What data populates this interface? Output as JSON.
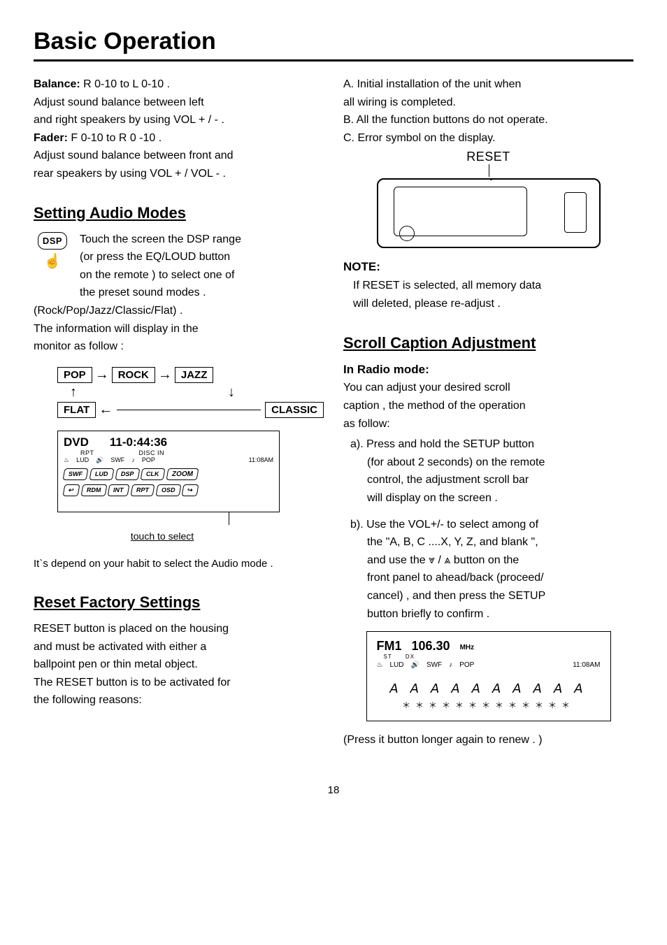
{
  "title": "Basic Operation",
  "left": {
    "balance_label": "Balance:",
    "balance_range": " R 0-10 to L 0-10 .",
    "balance_desc1": "Adjust sound balance between left",
    "balance_desc2": "and right speakers by using VOL + / - .",
    "fader_label": "Fader:",
    "fader_range": " F 0-10 to R 0 -10 .",
    "fader_desc1": "Adjust sound balance between front and",
    "fader_desc2": "rear speakers by using VOL + / VOL - .",
    "heading_audio": "Setting Audio Modes",
    "dsp_badge": "DSP",
    "dsp_text1": "Touch the screen the DSP range",
    "dsp_text2": "(or press the EQ/LOUD button",
    "dsp_text3": "on the remote ) to select one of",
    "dsp_text4": "the preset sound modes .",
    "dsp_after1": " (Rock/Pop/Jazz/Classic/Flat) .",
    "dsp_after2": "The information will display in the",
    "dsp_after3": "monitor as follow :",
    "flow": {
      "pop": "POP",
      "rock": "ROCK",
      "jazz": "JAZZ",
      "flat": "FLAT",
      "classic": "CLASSIC"
    },
    "dvd": {
      "name": "DVD",
      "time": "11-0:44:36",
      "rpt": "RPT",
      "discin": "DISC IN",
      "ico1": "LUD",
      "ico2": "SWF",
      "ico3": "POP",
      "clock": "11:08AM",
      "btn_row1": [
        "SWF",
        "LUD",
        "DSP",
        "CLK",
        "ZOOM"
      ],
      "btn_row2": [
        "↩",
        "RDM",
        "INT",
        "RPT",
        "OSD",
        "↪"
      ],
      "touch": "touch to select"
    },
    "habit_note": "It`s depend on your habit to select the Audio mode .",
    "heading_reset": "Reset Factory Settings",
    "reset_p1": "RESET button is placed on the housing",
    "reset_p2": "and must be activated with either a",
    "reset_p3": "ballpoint pen or thin metal object.",
    "reset_p4": "The RESET button  is to be activated for",
    "reset_p5": "the following reasons:"
  },
  "right": {
    "reasons": [
      "A. Initial installation of the unit when",
      "     all wiring is completed.",
      "B. All the function buttons do not operate.",
      "C. Error symbol on the display."
    ],
    "reset_label": "RESET",
    "note_label": "NOTE:",
    "note_l1": "If RESET is selected, all memory data",
    "note_l2": "will deleted, please re-adjust .",
    "heading_scroll": "Scroll Caption Adjustment",
    "radio_label": "In Radio mode:",
    "radio_p1": "You can adjust your desired scroll",
    "radio_p2": "caption , the method of the operation",
    "radio_p3": "as follow:",
    "a_label": "a). Press and hold the SETUP button",
    "a_l2": "(for about 2 seconds) on the remote",
    "a_l3": "control, the adjustment scroll bar",
    "a_l4": "will display on the screen .",
    "b_label": "b). Use the VOL+/-  to select among of",
    "b_l2": "the \"A, B, C ....X, Y, Z, and blank \",",
    "b_l3": "and use the ⩔ / ⩓  button on the",
    "b_l4": "front panel to ahead/back (proceed/",
    "b_l5": "cancel) ,  and then press the SETUP",
    "b_l6": "button briefly to confirm .",
    "radio_panel": {
      "band": "FM1",
      "freq": "106.30",
      "unit": "MHz",
      "st": "ST",
      "dx": "DX",
      "ico1": "LUD",
      "ico2": "SWF",
      "ico3": "POP",
      "time": "11:08AM",
      "scroll": "𝘈 𝘈 𝘈 𝘈 𝘈 𝘈 𝘈 𝘈 𝘈 𝘈",
      "stars": "＊＊＊＊＊＊＊＊＊＊＊＊＊"
    },
    "press_again": "(Press it button longer again to renew  . )"
  },
  "page": "18"
}
